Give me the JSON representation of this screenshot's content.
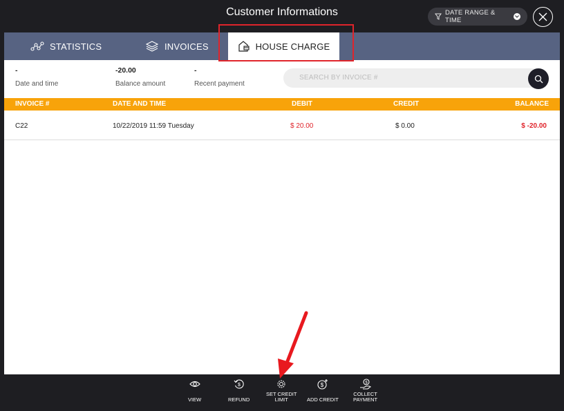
{
  "header": {
    "title": "Customer Informations",
    "date_range_label": "DATE RANGE & TIME"
  },
  "tabs": [
    {
      "label": "STATISTICS",
      "icon": "statistics-icon"
    },
    {
      "label": "INVOICES",
      "icon": "layers-icon"
    },
    {
      "label": "HOUSE CHARGE",
      "icon": "house-icon",
      "active": true
    }
  ],
  "summary": [
    {
      "value": "-",
      "label": "Date and time"
    },
    {
      "value": "-20.00",
      "label": "Balance amount"
    },
    {
      "value": "-",
      "label": "Recent payment"
    }
  ],
  "search": {
    "placeholder": "SEARCH BY INVOICE #"
  },
  "table": {
    "columns": [
      "INVOICE #",
      "DATE AND TIME",
      "DEBIT",
      "CREDIT",
      "BALANCE"
    ],
    "rows": [
      {
        "invoice": "C22",
        "date_time": "10/22/2019 11:59 Tuesday",
        "debit": "$ 20.00",
        "credit": "$ 0.00",
        "balance": "$ -20.00"
      }
    ]
  },
  "footer": {
    "view": "VIEW",
    "refund": "REFUND",
    "set_credit_limit_1": "SET CREDIT",
    "set_credit_limit_2": "LIMIT",
    "add_credit": "ADD CREDIT",
    "collect_payment_1": "COLLECT",
    "collect_payment_2": "PAYMENT"
  },
  "colors": {
    "tab_bar": "#576382",
    "table_header": "#f8a30a",
    "negative": "#e0242b",
    "annotation": "#e0242b"
  }
}
